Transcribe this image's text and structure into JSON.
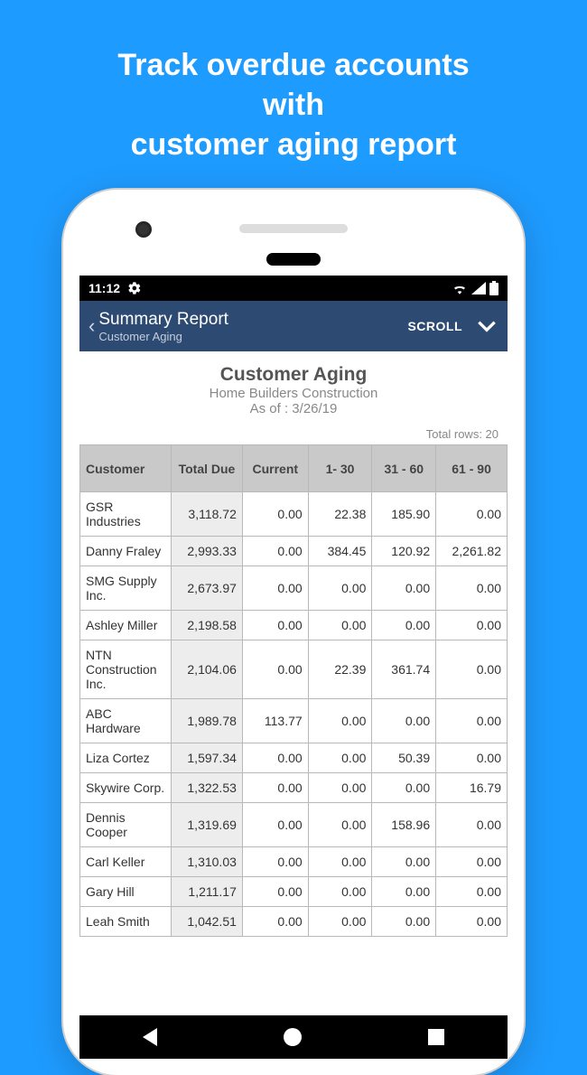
{
  "headline": "Track overdue accounts with\ncustomer aging report",
  "statusbar": {
    "time": "11:12"
  },
  "appbar": {
    "title": "Summary Report",
    "subtitle": "Customer Aging",
    "scroll_label": "SCROLL"
  },
  "report": {
    "title": "Customer Aging",
    "company": "Home Builders Construction",
    "asof": "As of : 3/26/19",
    "total_rows_label": "Total rows: 20"
  },
  "columns": [
    "Customer",
    "Total Due",
    "Current",
    "1- 30",
    "31 - 60",
    "61 - 90"
  ],
  "rows": [
    {
      "customer": "GSR Industries",
      "total_due": "3,118.72",
      "current": "0.00",
      "d1_30": "22.38",
      "d31_60": "185.90",
      "d61_90": "0.00"
    },
    {
      "customer": "Danny Fraley",
      "total_due": "2,993.33",
      "current": "0.00",
      "d1_30": "384.45",
      "d31_60": "120.92",
      "d61_90": "2,261.82"
    },
    {
      "customer": "SMG Supply Inc.",
      "total_due": "2,673.97",
      "current": "0.00",
      "d1_30": "0.00",
      "d31_60": "0.00",
      "d61_90": "0.00"
    },
    {
      "customer": "Ashley Miller",
      "total_due": "2,198.58",
      "current": "0.00",
      "d1_30": "0.00",
      "d31_60": "0.00",
      "d61_90": "0.00"
    },
    {
      "customer": "NTN Construction Inc.",
      "total_due": "2,104.06",
      "current": "0.00",
      "d1_30": "22.39",
      "d31_60": "361.74",
      "d61_90": "0.00"
    },
    {
      "customer": "ABC Hardware",
      "total_due": "1,989.78",
      "current": "113.77",
      "d1_30": "0.00",
      "d31_60": "0.00",
      "d61_90": "0.00"
    },
    {
      "customer": "Liza Cortez",
      "total_due": "1,597.34",
      "current": "0.00",
      "d1_30": "0.00",
      "d31_60": "50.39",
      "d61_90": "0.00"
    },
    {
      "customer": "Skywire Corp.",
      "total_due": "1,322.53",
      "current": "0.00",
      "d1_30": "0.00",
      "d31_60": "0.00",
      "d61_90": "16.79"
    },
    {
      "customer": "Dennis Cooper",
      "total_due": "1,319.69",
      "current": "0.00",
      "d1_30": "0.00",
      "d31_60": "158.96",
      "d61_90": "0.00"
    },
    {
      "customer": "Carl Keller",
      "total_due": "1,310.03",
      "current": "0.00",
      "d1_30": "0.00",
      "d31_60": "0.00",
      "d61_90": "0.00"
    },
    {
      "customer": "Gary Hill",
      "total_due": "1,211.17",
      "current": "0.00",
      "d1_30": "0.00",
      "d31_60": "0.00",
      "d61_90": "0.00"
    },
    {
      "customer": "Leah Smith",
      "total_due": "1,042.51",
      "current": "0.00",
      "d1_30": "0.00",
      "d31_60": "0.00",
      "d61_90": "0.00"
    }
  ]
}
